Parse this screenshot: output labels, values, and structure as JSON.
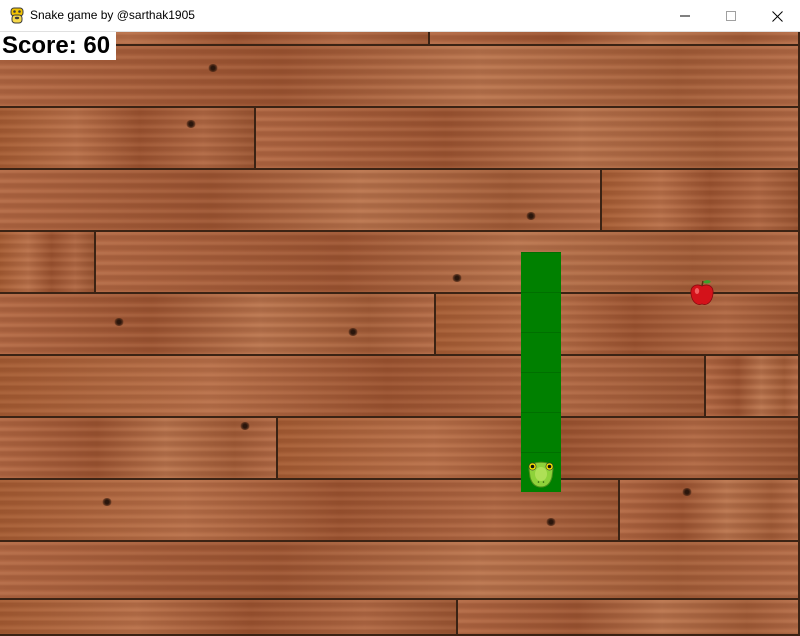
{
  "window": {
    "title": "Snake game by @sarthak1905",
    "icon": "python-icon",
    "controls": [
      "minimize-icon",
      "maximize-icon",
      "close-icon"
    ]
  },
  "game": {
    "score_text": "Score: 60",
    "background": "wood-planks",
    "snake": {
      "color": "#008000",
      "segments": 6,
      "direction": "down",
      "head": "snake-head-icon"
    },
    "food": "apple-icon"
  }
}
